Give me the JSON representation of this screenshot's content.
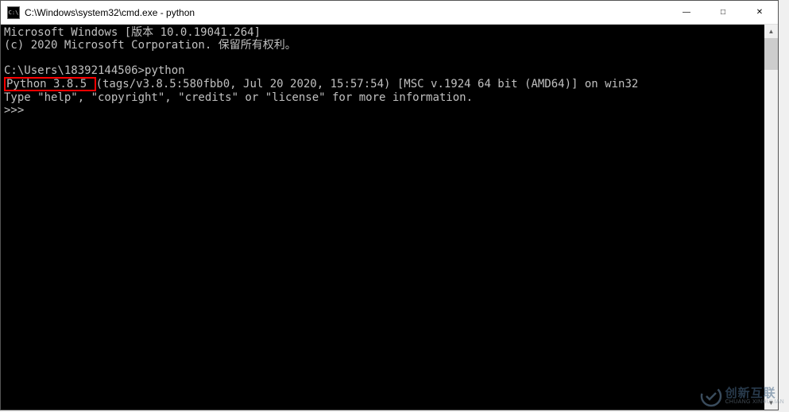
{
  "titlebar": {
    "icon_label": "C:\\",
    "title": "C:\\Windows\\system32\\cmd.exe - python"
  },
  "window_controls": {
    "minimize": "—",
    "maximize": "□",
    "close": "✕"
  },
  "terminal": {
    "line1": "Microsoft Windows [版本 10.0.19041.264]",
    "line2": "(c) 2020 Microsoft Corporation. 保留所有权利。",
    "line3_prompt": "C:\\Users\\18392144506>",
    "line3_cmd": "python",
    "line4_hl": "Python 3.8.5 ",
    "line4_rest": "(tags/v3.8.5:580fbb0, Jul 20 2020, 15:57:54) [MSC v.1924 64 bit (AMD64)] on win32",
    "line5": "Type \"help\", \"copyright\", \"credits\" or \"license\" for more information.",
    "line6_prompt": ">>> "
  },
  "watermark": {
    "main": "创新互联",
    "sub": "CHUANG XINHULIAN"
  }
}
